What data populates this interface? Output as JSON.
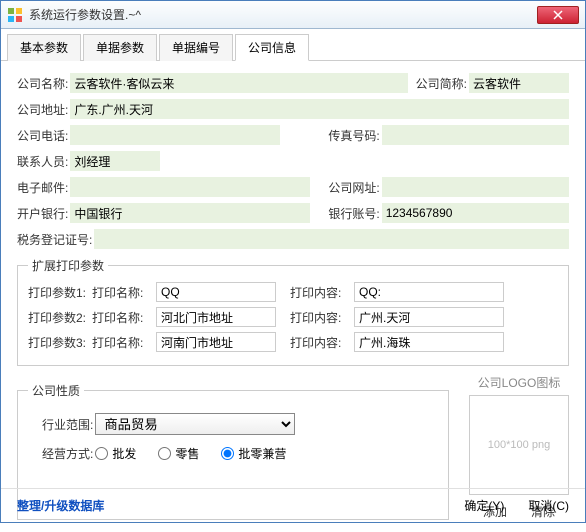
{
  "window": {
    "title": "系统运行参数设置.~^"
  },
  "tabs": [
    "基本参数",
    "单据参数",
    "单据编号",
    "公司信息"
  ],
  "activeTab": 3,
  "fields": {
    "companyName": {
      "label": "公司名称:",
      "value": "云客软件·客似云来"
    },
    "companyShort": {
      "label": "公司简称:",
      "value": "云客软件"
    },
    "companyAddr": {
      "label": "公司地址:",
      "value": "广东.广州.天河"
    },
    "companyTel": {
      "label": "公司电话:",
      "value": ""
    },
    "fax": {
      "label": "传真号码:",
      "value": ""
    },
    "contact": {
      "label": "联系人员:",
      "value": "刘经理"
    },
    "email": {
      "label": "电子邮件:",
      "value": ""
    },
    "website": {
      "label": "公司网址:",
      "value": ""
    },
    "bank": {
      "label": "开户银行:",
      "value": "中国银行"
    },
    "bankAccount": {
      "label": "银行账号:",
      "value": "1234567890"
    },
    "taxNo": {
      "label": "税务登记证号:",
      "value": ""
    }
  },
  "printExt": {
    "legend": "扩展打印参数",
    "rows": [
      {
        "param": "打印参数1:",
        "nameLabel": "打印名称:",
        "nameVal": "QQ",
        "contLabel": "打印内容:",
        "contVal": "QQ:"
      },
      {
        "param": "打印参数2:",
        "nameLabel": "打印名称:",
        "nameVal": "河北门市地址",
        "contLabel": "打印内容:",
        "contVal": "广州.天河"
      },
      {
        "param": "打印参数3:",
        "nameLabel": "打印名称:",
        "nameVal": "河南门市地址",
        "contLabel": "打印内容:",
        "contVal": "广州.海珠"
      }
    ]
  },
  "nature": {
    "legend": "公司性质",
    "industryLabel": "行业范围:",
    "industryValue": "商品贸易",
    "modeLabel": "经营方式:",
    "modes": [
      "批发",
      "零售",
      "批零兼营"
    ],
    "modeSelected": 2
  },
  "logo": {
    "label": "公司LOGO图标",
    "placeholder": "100*100 png",
    "add": "添加",
    "clear": "清除"
  },
  "footer": {
    "maintain": "整理/升级数据库",
    "ok": "确定(Y)",
    "cancel": "取消(C)"
  }
}
